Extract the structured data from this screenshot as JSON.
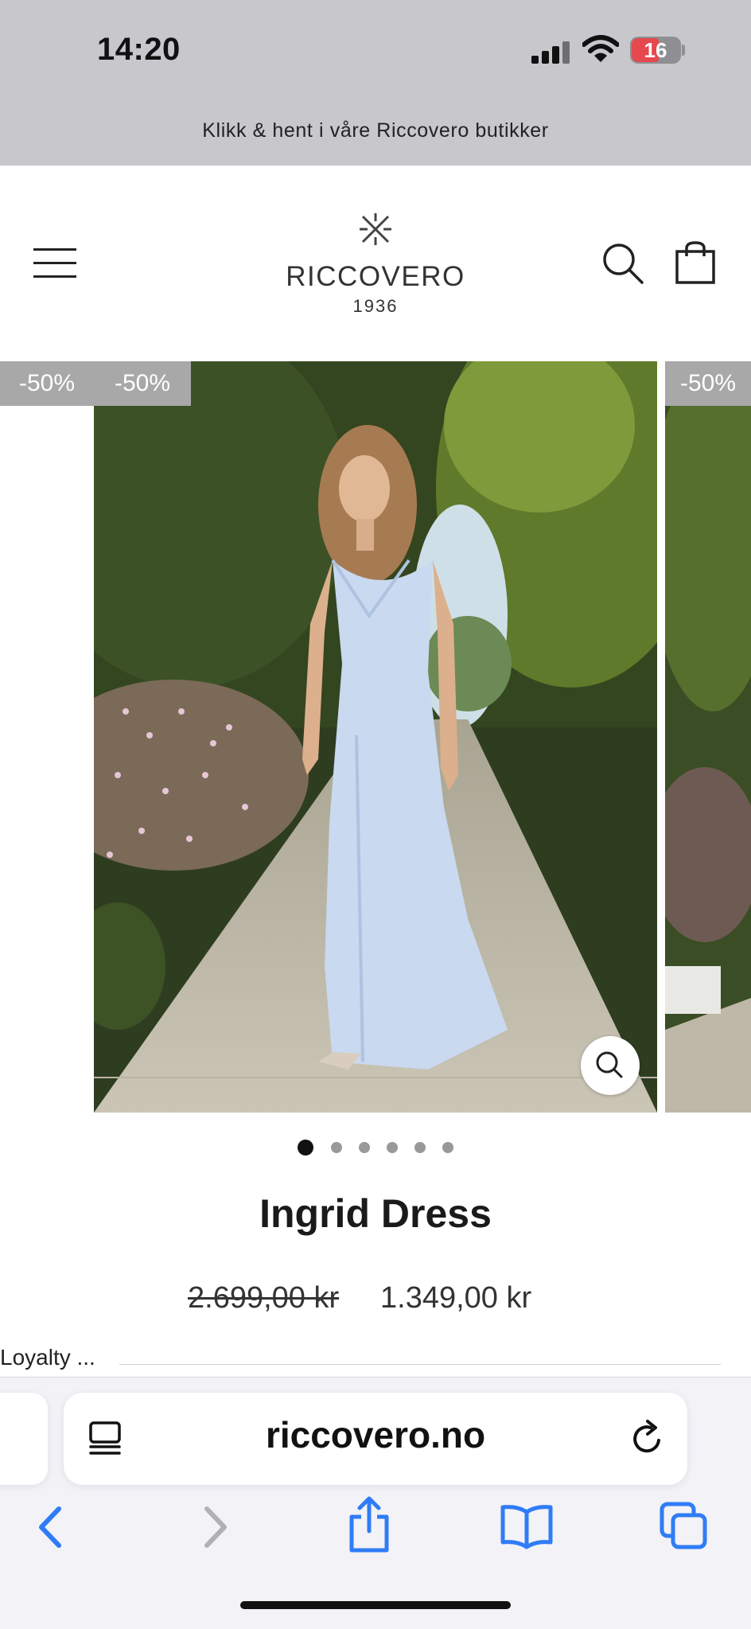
{
  "status_bar": {
    "time": "14:20",
    "battery": "16",
    "icons": [
      "cellular-signal-icon",
      "wifi-icon",
      "battery-icon"
    ]
  },
  "announcement": "Klikk & hent i våre Riccovero butikker",
  "header": {
    "brand": "RICCOVERO",
    "year": "1936",
    "icons": [
      "menu-icon",
      "search-icon",
      "shopping-bag-icon"
    ]
  },
  "gallery": {
    "badges": [
      "-50%",
      "-50%",
      "-50%"
    ],
    "slide_count": 6,
    "active_slide": 1,
    "icons": [
      "zoom-icon"
    ]
  },
  "product": {
    "title": "Ingrid Dress",
    "price_original": "2.699,00 kr",
    "price_sale": "1.349,00 kr",
    "loyalty_label": "Loyalty ..."
  },
  "browser": {
    "url": "riccovero.no",
    "icons": [
      "reader-mode-icon",
      "reload-icon",
      "back-icon",
      "forward-icon",
      "share-icon",
      "bookmarks-icon",
      "tabs-icon"
    ]
  },
  "colors": {
    "status_bg": "#c7c7cc",
    "badge_bg": "#a8a8a8",
    "safari_blue": "#2f7cf6",
    "dress": "#c9d9ef",
    "battery_low": "#e5484d"
  }
}
